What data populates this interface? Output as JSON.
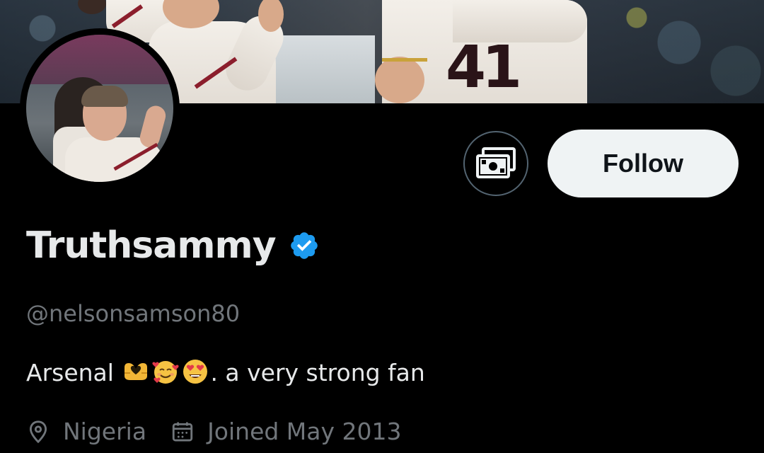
{
  "profile": {
    "display_name": "Truthsammy",
    "handle": "@nelsonsamson80",
    "bio_text_start": "Arsenal ",
    "bio_text_end": ". a very strong fan",
    "bio_emojis": [
      "heart-hands-emoji",
      "smiling-face-with-hearts-emoji",
      "heart-eyes-emoji"
    ],
    "location": "Nigeria",
    "joined": "Joined May 2013",
    "verified": true
  },
  "actions": {
    "follow_label": "Follow",
    "subscribe_icon": "money-icon"
  },
  "banner": {
    "jersey_number": "41"
  },
  "colors": {
    "background": "#000000",
    "primary_text": "#e7e9ea",
    "secondary_text": "#71767b",
    "verified_blue": "#1d9bf0",
    "follow_bg": "#eff3f4",
    "icon_border": "#536471"
  }
}
